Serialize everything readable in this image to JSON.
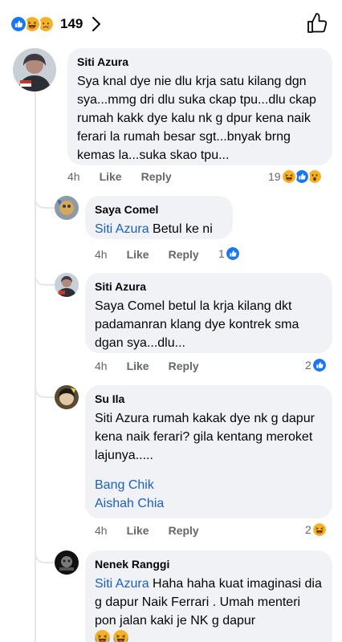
{
  "header": {
    "reaction_icons": [
      "like-icon",
      "haha-icon",
      "sad-icon"
    ],
    "reaction_count": "149"
  },
  "comments": [
    {
      "author": "Siti Azura",
      "text": "Sya knal dye nie dlu krja satu kilang dgn sya...mmg dri dlu suka ckap tpu...dlu ckap rumah kakk dye kalu nk g dpur kena naik ferari la rumah besar sgt...bnyak brng kemas la...suka skao tpu...",
      "time": "4h",
      "like": "Like",
      "reply": "Reply",
      "reaction_count": "19",
      "reaction_icons": [
        "haha-icon",
        "like-icon",
        "wow-icon"
      ]
    },
    {
      "author": "Saya Comel",
      "mention": "Siti Azura",
      "text": " Betul ke ni",
      "time": "4h",
      "like": "Like",
      "reply": "Reply",
      "reaction_count": "1",
      "reaction_icons": [
        "like-icon"
      ]
    },
    {
      "author": "Siti Azura",
      "text": "Saya Comel betul la krja kilang dkt padamanran klang dye kontrek sma dgan sya...dlu...",
      "time": "4h",
      "like": "Like",
      "reply": "Reply",
      "reaction_count": "2",
      "reaction_icons": [
        "like-icon"
      ]
    },
    {
      "author": "Su Ila",
      "text": "Siti Azura rumah kakak dye nk g dapur kena naik ferari? gila kentang meroket lajunya.....",
      "mention_1": "Bang Chik",
      "mention_2": "Aishah Chia",
      "time": "4h",
      "like": "Like",
      "reply": "Reply",
      "reaction_count": "2",
      "reaction_icons": [
        "haha-icon"
      ]
    },
    {
      "author": "Nenek Ranggi",
      "mention": "Siti Azura",
      "text": " Haha haha kuat imaginasi dia g dapur Naik Ferrari . Umah menteri pon jalan kaki je NK g dapur",
      "emojis": [
        "tears-of-joy-emoji",
        "tears-of-joy-emoji"
      ]
    }
  ],
  "colors": {
    "bubble": "#f0f2f5",
    "mention": "#1b5fc6",
    "meta": "#65676b",
    "like_blue": "#1877f2",
    "haha_yellow": "#f7b125"
  }
}
